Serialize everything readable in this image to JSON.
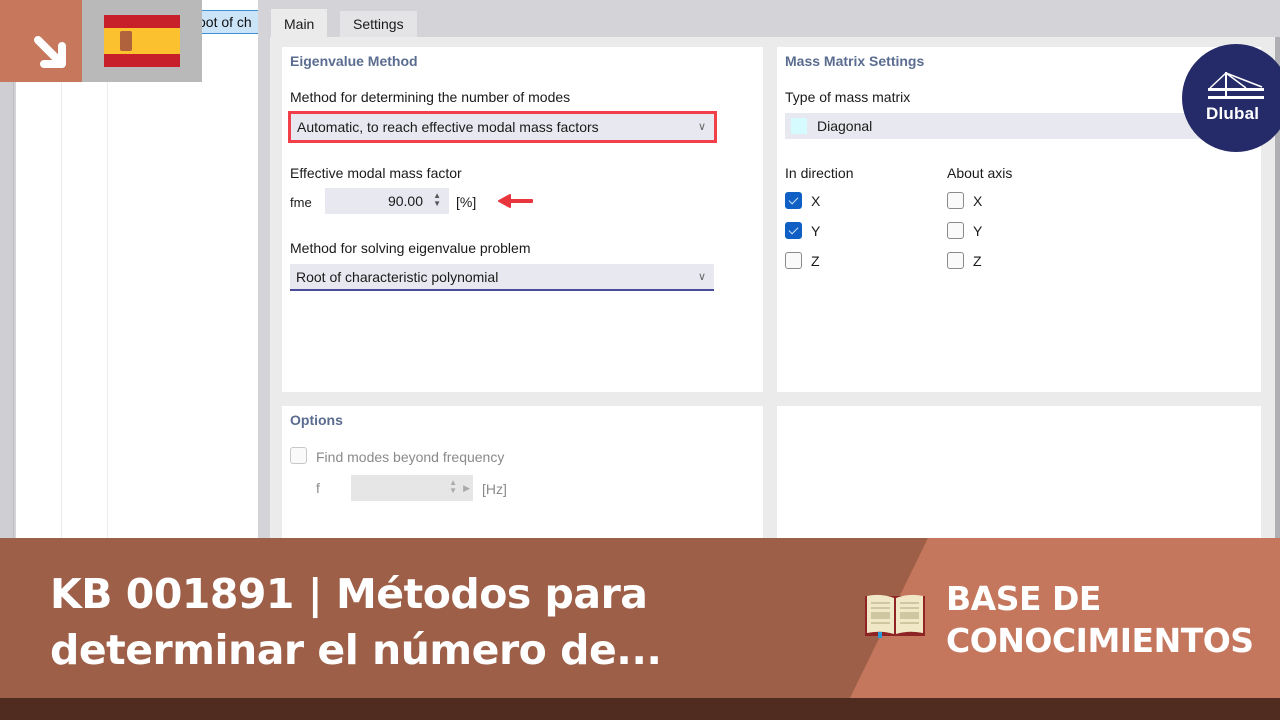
{
  "tree": {
    "selected_item_text": "oot of ch"
  },
  "tabs": [
    {
      "label": "Main",
      "active": true
    },
    {
      "label": "Settings",
      "active": false
    }
  ],
  "eigenvalue_method": {
    "title": "Eigenvalue Method",
    "modes_method_label": "Method for determining the number of modes",
    "modes_method_value": "Automatic, to reach effective modal mass factors",
    "factor_label": "Effective modal mass factor",
    "factor_symbol": "fme",
    "factor_value": "90.00",
    "factor_unit": "[%]",
    "solve_method_label": "Method for solving eigenvalue problem",
    "solve_method_value": "Root of characteristic polynomial"
  },
  "mass_matrix": {
    "title": "Mass Matrix Settings",
    "type_label": "Type of mass matrix",
    "type_value": "Diagonal",
    "type_swatch_color": "#d6fbff",
    "in_direction_label": "In direction",
    "about_axis_label": "About axis",
    "in_direction": [
      {
        "label": "X",
        "checked": true
      },
      {
        "label": "Y",
        "checked": true
      },
      {
        "label": "Z",
        "checked": false
      }
    ],
    "about_axis": [
      {
        "label": "X",
        "checked": false
      },
      {
        "label": "Y",
        "checked": false
      },
      {
        "label": "Z",
        "checked": false
      }
    ]
  },
  "options": {
    "title": "Options",
    "find_modes_label": "Find modes beyond frequency",
    "find_modes_checked": false,
    "freq_symbol": "f",
    "freq_value": "",
    "freq_unit": "[Hz]"
  },
  "branding": {
    "logo_text": "Dlubal",
    "banner_title": "KB 001891 | Métodos para determinar el número de...",
    "category_label": "BASE DE CONOCIMIENTOS",
    "language_flag": "spain-flag"
  },
  "colors": {
    "highlight_red": "#f2404a",
    "accent_blue": "#0f5fc4",
    "section_title": "#5a6c8f",
    "banner_dark": "#9e5f48",
    "banner_light": "#c4775c",
    "dlubal_navy": "#252b68"
  }
}
